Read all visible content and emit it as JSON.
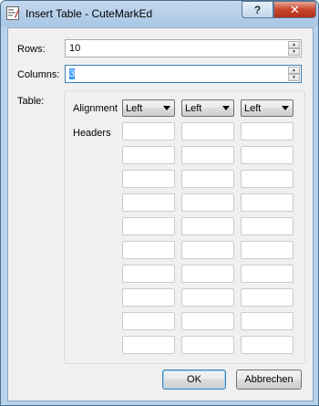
{
  "window": {
    "title": "Insert Table - CuteMarkEd",
    "help_label": "?",
    "close_label": "✕"
  },
  "form": {
    "rows": {
      "label": "Rows:",
      "value": "10"
    },
    "columns": {
      "label": "Columns:",
      "value": "3"
    },
    "table": {
      "label": "Table:",
      "alignment_label": "Alignment",
      "headers_label": "Headers",
      "alignments": [
        "Left",
        "Left",
        "Left"
      ]
    }
  },
  "buttons": {
    "ok": "OK",
    "cancel": "Abbrechen"
  },
  "icons": {
    "app": "cutemarked-app-icon",
    "spin_up": "spin-up-icon",
    "spin_down": "spin-down-icon",
    "dropdown": "chevron-down-icon"
  }
}
